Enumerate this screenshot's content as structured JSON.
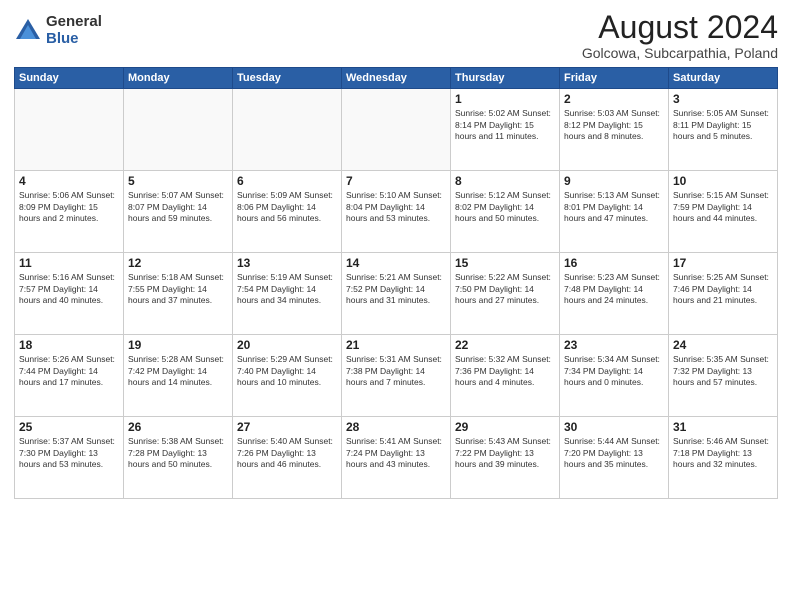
{
  "logo": {
    "general": "General",
    "blue": "Blue"
  },
  "title": "August 2024",
  "location": "Golcowa, Subcarpathia, Poland",
  "weekdays": [
    "Sunday",
    "Monday",
    "Tuesday",
    "Wednesday",
    "Thursday",
    "Friday",
    "Saturday"
  ],
  "weeks": [
    [
      {
        "day": "",
        "info": ""
      },
      {
        "day": "",
        "info": ""
      },
      {
        "day": "",
        "info": ""
      },
      {
        "day": "",
        "info": ""
      },
      {
        "day": "1",
        "info": "Sunrise: 5:02 AM\nSunset: 8:14 PM\nDaylight: 15 hours\nand 11 minutes."
      },
      {
        "day": "2",
        "info": "Sunrise: 5:03 AM\nSunset: 8:12 PM\nDaylight: 15 hours\nand 8 minutes."
      },
      {
        "day": "3",
        "info": "Sunrise: 5:05 AM\nSunset: 8:11 PM\nDaylight: 15 hours\nand 5 minutes."
      }
    ],
    [
      {
        "day": "4",
        "info": "Sunrise: 5:06 AM\nSunset: 8:09 PM\nDaylight: 15 hours\nand 2 minutes."
      },
      {
        "day": "5",
        "info": "Sunrise: 5:07 AM\nSunset: 8:07 PM\nDaylight: 14 hours\nand 59 minutes."
      },
      {
        "day": "6",
        "info": "Sunrise: 5:09 AM\nSunset: 8:06 PM\nDaylight: 14 hours\nand 56 minutes."
      },
      {
        "day": "7",
        "info": "Sunrise: 5:10 AM\nSunset: 8:04 PM\nDaylight: 14 hours\nand 53 minutes."
      },
      {
        "day": "8",
        "info": "Sunrise: 5:12 AM\nSunset: 8:02 PM\nDaylight: 14 hours\nand 50 minutes."
      },
      {
        "day": "9",
        "info": "Sunrise: 5:13 AM\nSunset: 8:01 PM\nDaylight: 14 hours\nand 47 minutes."
      },
      {
        "day": "10",
        "info": "Sunrise: 5:15 AM\nSunset: 7:59 PM\nDaylight: 14 hours\nand 44 minutes."
      }
    ],
    [
      {
        "day": "11",
        "info": "Sunrise: 5:16 AM\nSunset: 7:57 PM\nDaylight: 14 hours\nand 40 minutes."
      },
      {
        "day": "12",
        "info": "Sunrise: 5:18 AM\nSunset: 7:55 PM\nDaylight: 14 hours\nand 37 minutes."
      },
      {
        "day": "13",
        "info": "Sunrise: 5:19 AM\nSunset: 7:54 PM\nDaylight: 14 hours\nand 34 minutes."
      },
      {
        "day": "14",
        "info": "Sunrise: 5:21 AM\nSunset: 7:52 PM\nDaylight: 14 hours\nand 31 minutes."
      },
      {
        "day": "15",
        "info": "Sunrise: 5:22 AM\nSunset: 7:50 PM\nDaylight: 14 hours\nand 27 minutes."
      },
      {
        "day": "16",
        "info": "Sunrise: 5:23 AM\nSunset: 7:48 PM\nDaylight: 14 hours\nand 24 minutes."
      },
      {
        "day": "17",
        "info": "Sunrise: 5:25 AM\nSunset: 7:46 PM\nDaylight: 14 hours\nand 21 minutes."
      }
    ],
    [
      {
        "day": "18",
        "info": "Sunrise: 5:26 AM\nSunset: 7:44 PM\nDaylight: 14 hours\nand 17 minutes."
      },
      {
        "day": "19",
        "info": "Sunrise: 5:28 AM\nSunset: 7:42 PM\nDaylight: 14 hours\nand 14 minutes."
      },
      {
        "day": "20",
        "info": "Sunrise: 5:29 AM\nSunset: 7:40 PM\nDaylight: 14 hours\nand 10 minutes."
      },
      {
        "day": "21",
        "info": "Sunrise: 5:31 AM\nSunset: 7:38 PM\nDaylight: 14 hours\nand 7 minutes."
      },
      {
        "day": "22",
        "info": "Sunrise: 5:32 AM\nSunset: 7:36 PM\nDaylight: 14 hours\nand 4 minutes."
      },
      {
        "day": "23",
        "info": "Sunrise: 5:34 AM\nSunset: 7:34 PM\nDaylight: 14 hours\nand 0 minutes."
      },
      {
        "day": "24",
        "info": "Sunrise: 5:35 AM\nSunset: 7:32 PM\nDaylight: 13 hours\nand 57 minutes."
      }
    ],
    [
      {
        "day": "25",
        "info": "Sunrise: 5:37 AM\nSunset: 7:30 PM\nDaylight: 13 hours\nand 53 minutes."
      },
      {
        "day": "26",
        "info": "Sunrise: 5:38 AM\nSunset: 7:28 PM\nDaylight: 13 hours\nand 50 minutes."
      },
      {
        "day": "27",
        "info": "Sunrise: 5:40 AM\nSunset: 7:26 PM\nDaylight: 13 hours\nand 46 minutes."
      },
      {
        "day": "28",
        "info": "Sunrise: 5:41 AM\nSunset: 7:24 PM\nDaylight: 13 hours\nand 43 minutes."
      },
      {
        "day": "29",
        "info": "Sunrise: 5:43 AM\nSunset: 7:22 PM\nDaylight: 13 hours\nand 39 minutes."
      },
      {
        "day": "30",
        "info": "Sunrise: 5:44 AM\nSunset: 7:20 PM\nDaylight: 13 hours\nand 35 minutes."
      },
      {
        "day": "31",
        "info": "Sunrise: 5:46 AM\nSunset: 7:18 PM\nDaylight: 13 hours\nand 32 minutes."
      }
    ]
  ]
}
